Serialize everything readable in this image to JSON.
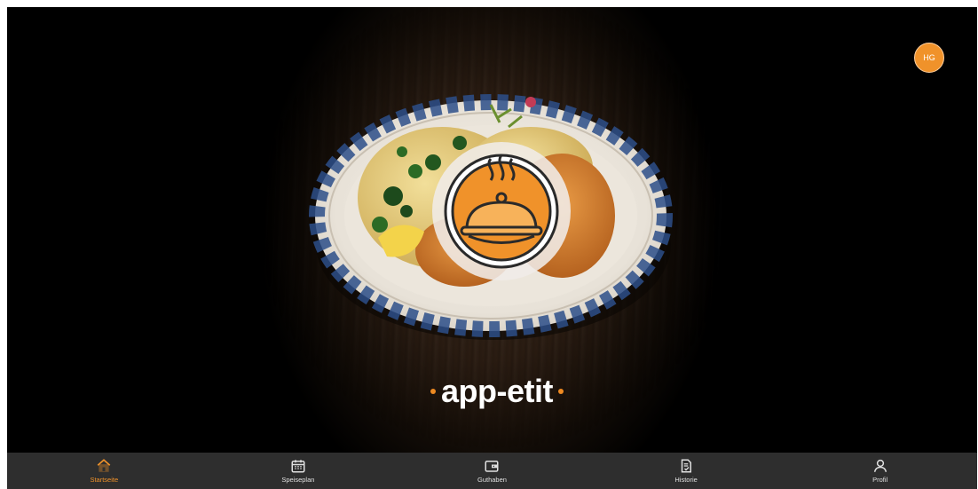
{
  "brand": {
    "name": "app-etit"
  },
  "user": {
    "initials": "HG"
  },
  "nav": {
    "items": [
      {
        "label": "Startseite",
        "icon": "home-icon",
        "active": true
      },
      {
        "label": "Speiseplan",
        "icon": "calendar-icon",
        "active": false
      },
      {
        "label": "Guthaben",
        "icon": "wallet-icon",
        "active": false
      },
      {
        "label": "Historie",
        "icon": "history-document-icon",
        "active": false
      },
      {
        "label": "Profil",
        "icon": "user-icon",
        "active": false
      }
    ]
  },
  "colors": {
    "accent": "#f0922a",
    "nav_bg": "#2e2e2e",
    "background": "#000000"
  }
}
